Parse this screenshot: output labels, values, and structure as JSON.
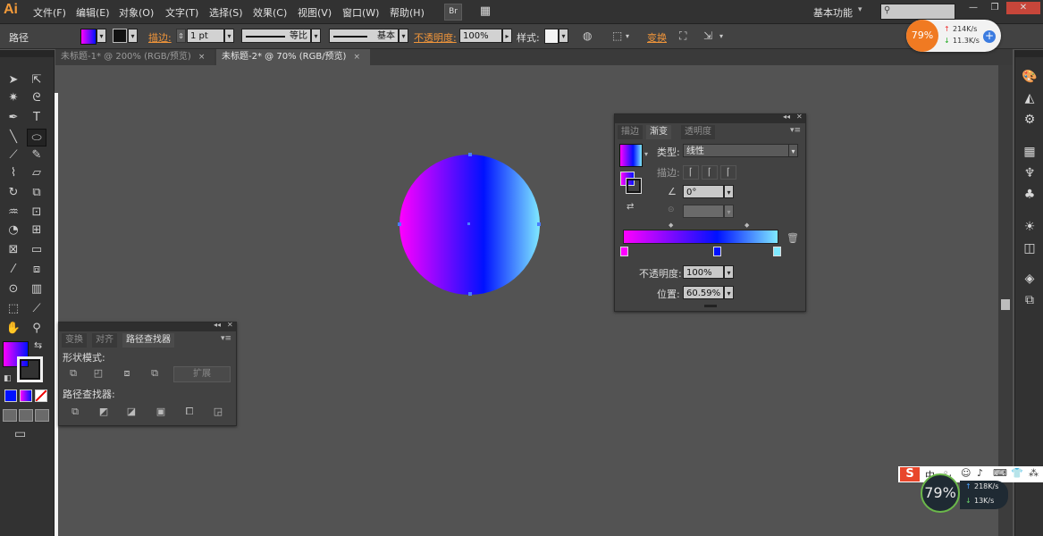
{
  "app": {
    "logo": "Ai"
  },
  "menu": [
    "文件(F)",
    "编辑(E)",
    "对象(O)",
    "文字(T)",
    "选择(S)",
    "效果(C)",
    "视图(V)",
    "窗口(W)",
    "帮助(H)"
  ],
  "menubar_buttons": {
    "bridge": "Br",
    "arrange": "▦"
  },
  "workspace": {
    "label": "基本功能",
    "caret": "▾"
  },
  "window_controls": {
    "minimize": "—",
    "restore": "❐",
    "close": "✕"
  },
  "control_bar": {
    "selection_label": "路径",
    "stroke_label": "描边:",
    "stroke_weight": "1 pt",
    "profile_label": "等比",
    "brush_label": "基本",
    "opacity_label": "不透明度:",
    "opacity_value": "100%",
    "style_label": "样式:",
    "transform_label": "变换"
  },
  "tabs": [
    {
      "label": "未标题-1* @ 200% (RGB/预览)",
      "close": "×"
    },
    {
      "label": "未标题-2* @ 70% (RGB/预览)",
      "close": "×"
    }
  ],
  "speed_widget": {
    "percent": "79%",
    "up": "214K/s",
    "down": "11.3K/s",
    "plus": "+"
  },
  "bottom_widget": {
    "percent": "79%",
    "up": "218K/s",
    "down": "13K/s",
    "ime": "中"
  },
  "gradient_panel": {
    "tabs": [
      "描边",
      "渐变",
      "透明度"
    ],
    "type_label": "类型:",
    "type_value": "线性",
    "stroke_label": "描边:",
    "angle_value": "0°",
    "opacity_label": "不透明度:",
    "opacity_value": "100%",
    "location_label": "位置:",
    "location_value": "60.59%",
    "stops": [
      {
        "color": "#ff00ff",
        "location": 0
      },
      {
        "color": "#0011ff",
        "location": 60.59
      },
      {
        "color": "#7fe9ff",
        "location": 100
      }
    ]
  },
  "pathfinder_panel": {
    "tabs": [
      "变换",
      "对齐",
      "路径查找器"
    ],
    "shape_modes_label": "形状模式:",
    "pathfinders_label": "路径查找器:",
    "expand_label": "扩展"
  },
  "colors": {
    "accent": "#f0953a",
    "gradient_start": "#ff00ff",
    "gradient_mid": "#0011ff",
    "gradient_end": "#7fe9ff"
  }
}
